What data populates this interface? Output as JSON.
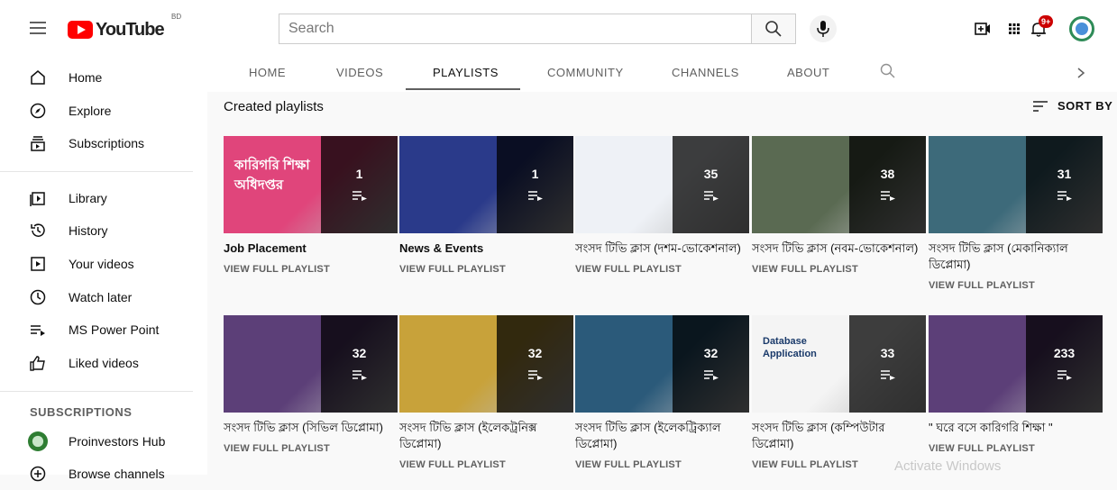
{
  "masthead": {
    "logo_text": "YouTube",
    "country_code": "BD",
    "search_placeholder": "Search",
    "notification_count": "9+"
  },
  "sidebar": {
    "items": [
      {
        "label": "Home",
        "icon": "home-icon"
      },
      {
        "label": "Explore",
        "icon": "compass-icon"
      },
      {
        "label": "Subscriptions",
        "icon": "subscriptions-icon"
      },
      {
        "label": "Library",
        "icon": "library-icon"
      },
      {
        "label": "History",
        "icon": "history-icon"
      },
      {
        "label": "Your videos",
        "icon": "your-videos-icon"
      },
      {
        "label": "Watch later",
        "icon": "clock-icon"
      },
      {
        "label": "MS Power Point",
        "icon": "playlist-icon"
      },
      {
        "label": "Liked videos",
        "icon": "thumbs-up-icon"
      }
    ],
    "subscriptions_heading": "SUBSCRIPTIONS",
    "subscriptions": [
      {
        "label": "Proinvestors Hub"
      },
      {
        "label": "Browse channels"
      }
    ]
  },
  "tabs": [
    {
      "label": "HOME"
    },
    {
      "label": "VIDEOS"
    },
    {
      "label": "PLAYLISTS"
    },
    {
      "label": "COMMUNITY"
    },
    {
      "label": "CHANNELS"
    },
    {
      "label": "ABOUT"
    }
  ],
  "content": {
    "section_title": "Created playlists",
    "sort_label": "SORT BY",
    "view_full_label": "VIEW FULL PLAYLIST",
    "playlists": [
      {
        "title": "Job Placement",
        "count": "1",
        "bg": "#e0457b",
        "thumb_text": "কারিগরি শিক্ষা অধিদপ্তর"
      },
      {
        "title": "News & Events",
        "count": "1",
        "bg": "#2a3a8a"
      },
      {
        "title": "সংসদ টিভি ক্লাস (দশম-ভোকেশনাল)",
        "count": "35",
        "bg": "#eef1f6"
      },
      {
        "title": "সংসদ টিভি ক্লাস (নবম-ভোকেশনাল)",
        "count": "38",
        "bg": "#5a6a52"
      },
      {
        "title": "সংসদ টিভি ক্লাস (মেকানিক্যাল ডিপ্লোমা)",
        "count": "31",
        "bg": "#3d6a7a"
      },
      {
        "title": "সংসদ টিভি ক্লাস (সিভিল ডিপ্লোমা)",
        "count": "32",
        "bg": "#5c3f78"
      },
      {
        "title": "সংসদ টিভি ক্লাস (ইলেকট্রনিক্স ডিপ্লোমা)",
        "count": "32",
        "bg": "#c8a23a"
      },
      {
        "title": "সংসদ টিভি ক্লাস (ইলেকট্রিক্যাল ডিপ্লোমা)",
        "count": "32",
        "bg": "#2b5a7a"
      },
      {
        "title": "সংসদ টিভি ক্লাস (কম্পিউটার ডিপ্লোমা)",
        "count": "33",
        "bg": "#f4f4f4",
        "thumb_text": "Database Application"
      },
      {
        "title": "\" ঘরে বসে কারিগরি শিক্ষা \"",
        "count": "233",
        "bg": "#5c3f78"
      }
    ]
  },
  "watermark": "Activate Windows"
}
